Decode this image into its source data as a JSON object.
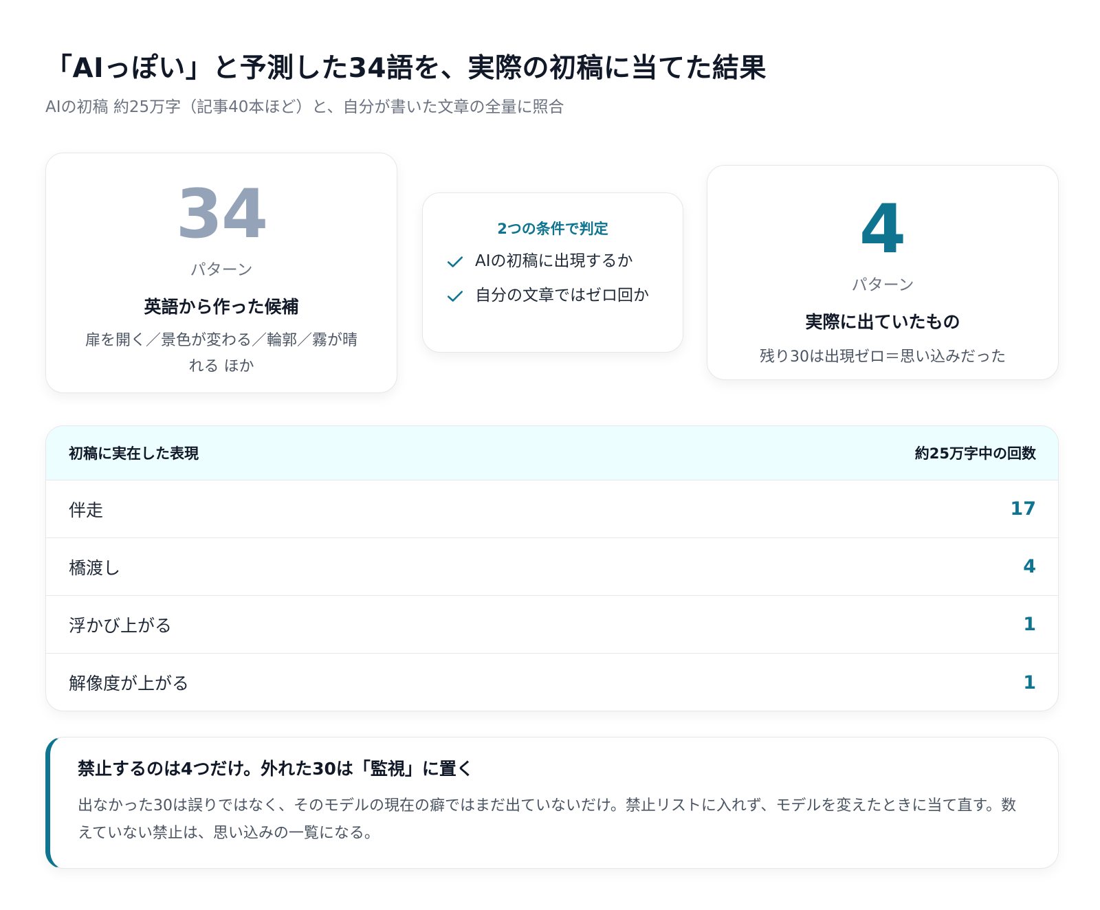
{
  "header": {
    "title": "「AIっぽい」と予測した34語を、実際の初稿に当てた結果",
    "subtitle": "AIの初稿 約25万字（記事40本ほど）と、自分が書いた文章の全量に照合"
  },
  "candidates_card": {
    "number": "34",
    "unit": "パターン",
    "title": "英語から作った候補",
    "description": "扉を開く／景色が変わる／輪郭／霧が晴れる ほか"
  },
  "criteria_card": {
    "title": "2つの条件で判定",
    "items": [
      "AIの初稿に出現するか",
      "自分の文章ではゼロ回か"
    ],
    "icon": "check-icon"
  },
  "result_card": {
    "number": "4",
    "unit": "パターン",
    "title": "実際に出ていたもの",
    "description": "残り30は出現ゼロ＝思い込みだった"
  },
  "table": {
    "headers": [
      "初稿に実在した表現",
      "約25万字中の回数"
    ],
    "rows": [
      {
        "label": "伴走",
        "count": "17"
      },
      {
        "label": "橋渡し",
        "count": "4"
      },
      {
        "label": "浮かび上がる",
        "count": "1"
      },
      {
        "label": "解像度が上がる",
        "count": "1"
      }
    ]
  },
  "note": {
    "title": "禁止するのは4つだけ。外れた30は「監視」に置く",
    "body": "出なかった30は誤りではなく、そのモデルの現在の癖ではまだ出ていないだけ。禁止リストに入れず、モデルを変えたときに当て直す。数えていない禁止は、思い込みの一覧になる。"
  },
  "colors": {
    "accent": "#0e7490",
    "muted_number": "#94a3b8",
    "table_header_bg": "#ecfeff"
  }
}
